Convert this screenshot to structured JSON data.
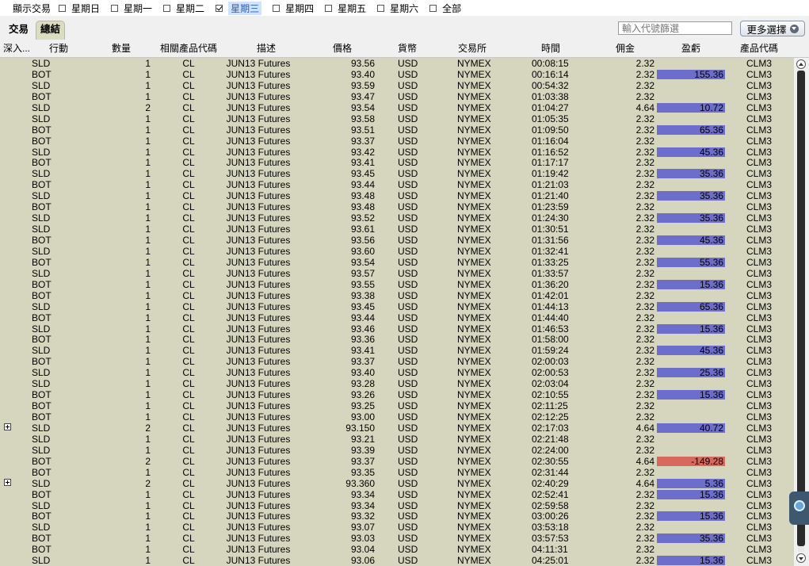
{
  "filter": {
    "title": "顯示交易",
    "days": [
      {
        "label": "星期日",
        "checked": false
      },
      {
        "label": "星期一",
        "checked": false
      },
      {
        "label": "星期二",
        "checked": false
      },
      {
        "label": "星期三",
        "checked": true
      },
      {
        "label": "星期四",
        "checked": false
      },
      {
        "label": "星期五",
        "checked": false
      },
      {
        "label": "星期六",
        "checked": false
      },
      {
        "label": "全部",
        "checked": false
      }
    ]
  },
  "tabs": [
    {
      "label": "交易",
      "active": false
    },
    {
      "label": "總結",
      "active": true
    }
  ],
  "search": {
    "placeholder": "輸入代號篩選"
  },
  "more_button": {
    "label": "更多選擇"
  },
  "columns": {
    "drill": "深入...",
    "action": "行動",
    "qty": "數量",
    "underlying": "相關產品代碼",
    "desc": "描述",
    "price": "價格",
    "currency": "貨幣",
    "exchange": "交易所",
    "time": "時間",
    "commission": "佣金",
    "pnl": "盈虧",
    "symbol": "產品代碼"
  },
  "colors": {
    "row_bg": "#d6d6bf",
    "pnl_positive": "#6d6dcc",
    "pnl_negative": "#d8685e"
  },
  "trades": [
    {
      "action": "SLD",
      "qty": "1",
      "underlying": "CL",
      "desc": "JUN13 Futures",
      "price": "93.56",
      "currency": "USD",
      "exchange": "NYMEX",
      "time": "00:08:15",
      "commission": "2.32",
      "pnl": "",
      "symbol": "CLM3",
      "expand": false
    },
    {
      "action": "BOT",
      "qty": "1",
      "underlying": "CL",
      "desc": "JUN13 Futures",
      "price": "93.40",
      "currency": "USD",
      "exchange": "NYMEX",
      "time": "00:16:14",
      "commission": "2.32",
      "pnl": "155.36",
      "symbol": "CLM3",
      "expand": false
    },
    {
      "action": "SLD",
      "qty": "1",
      "underlying": "CL",
      "desc": "JUN13 Futures",
      "price": "93.59",
      "currency": "USD",
      "exchange": "NYMEX",
      "time": "00:54:32",
      "commission": "2.32",
      "pnl": "",
      "symbol": "CLM3",
      "expand": false
    },
    {
      "action": "BOT",
      "qty": "1",
      "underlying": "CL",
      "desc": "JUN13 Futures",
      "price": "93.47",
      "currency": "USD",
      "exchange": "NYMEX",
      "time": "01:03:38",
      "commission": "2.32",
      "pnl": "",
      "symbol": "CLM3",
      "expand": false
    },
    {
      "action": "SLD",
      "qty": "2",
      "underlying": "CL",
      "desc": "JUN13 Futures",
      "price": "93.54",
      "currency": "USD",
      "exchange": "NYMEX",
      "time": "01:04:27",
      "commission": "4.64",
      "pnl": "10.72",
      "symbol": "CLM3",
      "expand": false
    },
    {
      "action": "SLD",
      "qty": "1",
      "underlying": "CL",
      "desc": "JUN13 Futures",
      "price": "93.58",
      "currency": "USD",
      "exchange": "NYMEX",
      "time": "01:05:35",
      "commission": "2.32",
      "pnl": "",
      "symbol": "CLM3",
      "expand": false
    },
    {
      "action": "BOT",
      "qty": "1",
      "underlying": "CL",
      "desc": "JUN13 Futures",
      "price": "93.51",
      "currency": "USD",
      "exchange": "NYMEX",
      "time": "01:09:50",
      "commission": "2.32",
      "pnl": "65.36",
      "symbol": "CLM3",
      "expand": false
    },
    {
      "action": "BOT",
      "qty": "1",
      "underlying": "CL",
      "desc": "JUN13 Futures",
      "price": "93.37",
      "currency": "USD",
      "exchange": "NYMEX",
      "time": "01:16:04",
      "commission": "2.32",
      "pnl": "",
      "symbol": "CLM3",
      "expand": false
    },
    {
      "action": "SLD",
      "qty": "1",
      "underlying": "CL",
      "desc": "JUN13 Futures",
      "price": "93.42",
      "currency": "USD",
      "exchange": "NYMEX",
      "time": "01:16:52",
      "commission": "2.32",
      "pnl": "45.36",
      "symbol": "CLM3",
      "expand": false
    },
    {
      "action": "BOT",
      "qty": "1",
      "underlying": "CL",
      "desc": "JUN13 Futures",
      "price": "93.41",
      "currency": "USD",
      "exchange": "NYMEX",
      "time": "01:17:17",
      "commission": "2.32",
      "pnl": "",
      "symbol": "CLM3",
      "expand": false
    },
    {
      "action": "SLD",
      "qty": "1",
      "underlying": "CL",
      "desc": "JUN13 Futures",
      "price": "93.45",
      "currency": "USD",
      "exchange": "NYMEX",
      "time": "01:19:42",
      "commission": "2.32",
      "pnl": "35.36",
      "symbol": "CLM3",
      "expand": false
    },
    {
      "action": "BOT",
      "qty": "1",
      "underlying": "CL",
      "desc": "JUN13 Futures",
      "price": "93.44",
      "currency": "USD",
      "exchange": "NYMEX",
      "time": "01:21:03",
      "commission": "2.32",
      "pnl": "",
      "symbol": "CLM3",
      "expand": false
    },
    {
      "action": "SLD",
      "qty": "1",
      "underlying": "CL",
      "desc": "JUN13 Futures",
      "price": "93.48",
      "currency": "USD",
      "exchange": "NYMEX",
      "time": "01:21:40",
      "commission": "2.32",
      "pnl": "35.36",
      "symbol": "CLM3",
      "expand": false
    },
    {
      "action": "BOT",
      "qty": "1",
      "underlying": "CL",
      "desc": "JUN13 Futures",
      "price": "93.48",
      "currency": "USD",
      "exchange": "NYMEX",
      "time": "01:23:59",
      "commission": "2.32",
      "pnl": "",
      "symbol": "CLM3",
      "expand": false
    },
    {
      "action": "SLD",
      "qty": "1",
      "underlying": "CL",
      "desc": "JUN13 Futures",
      "price": "93.52",
      "currency": "USD",
      "exchange": "NYMEX",
      "time": "01:24:30",
      "commission": "2.32",
      "pnl": "35.36",
      "symbol": "CLM3",
      "expand": false
    },
    {
      "action": "SLD",
      "qty": "1",
      "underlying": "CL",
      "desc": "JUN13 Futures",
      "price": "93.61",
      "currency": "USD",
      "exchange": "NYMEX",
      "time": "01:30:51",
      "commission": "2.32",
      "pnl": "",
      "symbol": "CLM3",
      "expand": false
    },
    {
      "action": "BOT",
      "qty": "1",
      "underlying": "CL",
      "desc": "JUN13 Futures",
      "price": "93.56",
      "currency": "USD",
      "exchange": "NYMEX",
      "time": "01:31:56",
      "commission": "2.32",
      "pnl": "45.36",
      "symbol": "CLM3",
      "expand": false
    },
    {
      "action": "SLD",
      "qty": "1",
      "underlying": "CL",
      "desc": "JUN13 Futures",
      "price": "93.60",
      "currency": "USD",
      "exchange": "NYMEX",
      "time": "01:32:41",
      "commission": "2.32",
      "pnl": "",
      "symbol": "CLM3",
      "expand": false
    },
    {
      "action": "BOT",
      "qty": "1",
      "underlying": "CL",
      "desc": "JUN13 Futures",
      "price": "93.54",
      "currency": "USD",
      "exchange": "NYMEX",
      "time": "01:33:25",
      "commission": "2.32",
      "pnl": "55.36",
      "symbol": "CLM3",
      "expand": false
    },
    {
      "action": "SLD",
      "qty": "1",
      "underlying": "CL",
      "desc": "JUN13 Futures",
      "price": "93.57",
      "currency": "USD",
      "exchange": "NYMEX",
      "time": "01:33:57",
      "commission": "2.32",
      "pnl": "",
      "symbol": "CLM3",
      "expand": false
    },
    {
      "action": "BOT",
      "qty": "1",
      "underlying": "CL",
      "desc": "JUN13 Futures",
      "price": "93.55",
      "currency": "USD",
      "exchange": "NYMEX",
      "time": "01:36:20",
      "commission": "2.32",
      "pnl": "15.36",
      "symbol": "CLM3",
      "expand": false
    },
    {
      "action": "BOT",
      "qty": "1",
      "underlying": "CL",
      "desc": "JUN13 Futures",
      "price": "93.38",
      "currency": "USD",
      "exchange": "NYMEX",
      "time": "01:42:01",
      "commission": "2.32",
      "pnl": "",
      "symbol": "CLM3",
      "expand": false
    },
    {
      "action": "SLD",
      "qty": "1",
      "underlying": "CL",
      "desc": "JUN13 Futures",
      "price": "93.45",
      "currency": "USD",
      "exchange": "NYMEX",
      "time": "01:44:13",
      "commission": "2.32",
      "pnl": "65.36",
      "symbol": "CLM3",
      "expand": false
    },
    {
      "action": "BOT",
      "qty": "1",
      "underlying": "CL",
      "desc": "JUN13 Futures",
      "price": "93.44",
      "currency": "USD",
      "exchange": "NYMEX",
      "time": "01:44:40",
      "commission": "2.32",
      "pnl": "",
      "symbol": "CLM3",
      "expand": false
    },
    {
      "action": "SLD",
      "qty": "1",
      "underlying": "CL",
      "desc": "JUN13 Futures",
      "price": "93.46",
      "currency": "USD",
      "exchange": "NYMEX",
      "time": "01:46:53",
      "commission": "2.32",
      "pnl": "15.36",
      "symbol": "CLM3",
      "expand": false
    },
    {
      "action": "BOT",
      "qty": "1",
      "underlying": "CL",
      "desc": "JUN13 Futures",
      "price": "93.36",
      "currency": "USD",
      "exchange": "NYMEX",
      "time": "01:58:00",
      "commission": "2.32",
      "pnl": "",
      "symbol": "CLM3",
      "expand": false
    },
    {
      "action": "SLD",
      "qty": "1",
      "underlying": "CL",
      "desc": "JUN13 Futures",
      "price": "93.41",
      "currency": "USD",
      "exchange": "NYMEX",
      "time": "01:59:24",
      "commission": "2.32",
      "pnl": "45.36",
      "symbol": "CLM3",
      "expand": false
    },
    {
      "action": "BOT",
      "qty": "1",
      "underlying": "CL",
      "desc": "JUN13 Futures",
      "price": "93.37",
      "currency": "USD",
      "exchange": "NYMEX",
      "time": "02:00:03",
      "commission": "2.32",
      "pnl": "",
      "symbol": "CLM3",
      "expand": false
    },
    {
      "action": "SLD",
      "qty": "1",
      "underlying": "CL",
      "desc": "JUN13 Futures",
      "price": "93.40",
      "currency": "USD",
      "exchange": "NYMEX",
      "time": "02:00:53",
      "commission": "2.32",
      "pnl": "25.36",
      "symbol": "CLM3",
      "expand": false
    },
    {
      "action": "SLD",
      "qty": "1",
      "underlying": "CL",
      "desc": "JUN13 Futures",
      "price": "93.28",
      "currency": "USD",
      "exchange": "NYMEX",
      "time": "02:03:04",
      "commission": "2.32",
      "pnl": "",
      "symbol": "CLM3",
      "expand": false
    },
    {
      "action": "BOT",
      "qty": "1",
      "underlying": "CL",
      "desc": "JUN13 Futures",
      "price": "93.26",
      "currency": "USD",
      "exchange": "NYMEX",
      "time": "02:10:55",
      "commission": "2.32",
      "pnl": "15.36",
      "symbol": "CLM3",
      "expand": false
    },
    {
      "action": "BOT",
      "qty": "1",
      "underlying": "CL",
      "desc": "JUN13 Futures",
      "price": "93.25",
      "currency": "USD",
      "exchange": "NYMEX",
      "time": "02:11:25",
      "commission": "2.32",
      "pnl": "",
      "symbol": "CLM3",
      "expand": false
    },
    {
      "action": "BOT",
      "qty": "1",
      "underlying": "CL",
      "desc": "JUN13 Futures",
      "price": "93.00",
      "currency": "USD",
      "exchange": "NYMEX",
      "time": "02:12:25",
      "commission": "2.32",
      "pnl": "",
      "symbol": "CLM3",
      "expand": false
    },
    {
      "action": "SLD",
      "qty": "2",
      "underlying": "CL",
      "desc": "JUN13 Futures",
      "price": "93.150",
      "currency": "USD",
      "exchange": "NYMEX",
      "time": "02:17:03",
      "commission": "4.64",
      "pnl": "40.72",
      "symbol": "CLM3",
      "expand": true
    },
    {
      "action": "SLD",
      "qty": "1",
      "underlying": "CL",
      "desc": "JUN13 Futures",
      "price": "93.21",
      "currency": "USD",
      "exchange": "NYMEX",
      "time": "02:21:48",
      "commission": "2.32",
      "pnl": "",
      "symbol": "CLM3",
      "expand": false
    },
    {
      "action": "SLD",
      "qty": "1",
      "underlying": "CL",
      "desc": "JUN13 Futures",
      "price": "93.39",
      "currency": "USD",
      "exchange": "NYMEX",
      "time": "02:24:00",
      "commission": "2.32",
      "pnl": "",
      "symbol": "CLM3",
      "expand": false
    },
    {
      "action": "BOT",
      "qty": "2",
      "underlying": "CL",
      "desc": "JUN13 Futures",
      "price": "93.37",
      "currency": "USD",
      "exchange": "NYMEX",
      "time": "02:30:55",
      "commission": "4.64",
      "pnl": "-149.28",
      "symbol": "CLM3",
      "expand": false
    },
    {
      "action": "BOT",
      "qty": "1",
      "underlying": "CL",
      "desc": "JUN13 Futures",
      "price": "93.35",
      "currency": "USD",
      "exchange": "NYMEX",
      "time": "02:31:44",
      "commission": "2.32",
      "pnl": "",
      "symbol": "CLM3",
      "expand": false
    },
    {
      "action": "SLD",
      "qty": "2",
      "underlying": "CL",
      "desc": "JUN13 Futures",
      "price": "93.360",
      "currency": "USD",
      "exchange": "NYMEX",
      "time": "02:40:29",
      "commission": "4.64",
      "pnl": "5.36",
      "symbol": "CLM3",
      "expand": true
    },
    {
      "action": "BOT",
      "qty": "1",
      "underlying": "CL",
      "desc": "JUN13 Futures",
      "price": "93.34",
      "currency": "USD",
      "exchange": "NYMEX",
      "time": "02:52:41",
      "commission": "2.32",
      "pnl": "15.36",
      "symbol": "CLM3",
      "expand": false
    },
    {
      "action": "SLD",
      "qty": "1",
      "underlying": "CL",
      "desc": "JUN13 Futures",
      "price": "93.34",
      "currency": "USD",
      "exchange": "NYMEX",
      "time": "02:59:58",
      "commission": "2.32",
      "pnl": "",
      "symbol": "CLM3",
      "expand": false
    },
    {
      "action": "BOT",
      "qty": "1",
      "underlying": "CL",
      "desc": "JUN13 Futures",
      "price": "93.32",
      "currency": "USD",
      "exchange": "NYMEX",
      "time": "03:00:26",
      "commission": "2.32",
      "pnl": "15.36",
      "symbol": "CLM3",
      "expand": false
    },
    {
      "action": "SLD",
      "qty": "1",
      "underlying": "CL",
      "desc": "JUN13 Futures",
      "price": "93.07",
      "currency": "USD",
      "exchange": "NYMEX",
      "time": "03:53:18",
      "commission": "2.32",
      "pnl": "",
      "symbol": "CLM3",
      "expand": false
    },
    {
      "action": "BOT",
      "qty": "1",
      "underlying": "CL",
      "desc": "JUN13 Futures",
      "price": "93.03",
      "currency": "USD",
      "exchange": "NYMEX",
      "time": "03:57:53",
      "commission": "2.32",
      "pnl": "35.36",
      "symbol": "CLM3",
      "expand": false
    },
    {
      "action": "BOT",
      "qty": "1",
      "underlying": "CL",
      "desc": "JUN13 Futures",
      "price": "93.04",
      "currency": "USD",
      "exchange": "NYMEX",
      "time": "04:11:31",
      "commission": "2.32",
      "pnl": "",
      "symbol": "CLM3",
      "expand": false
    },
    {
      "action": "SLD",
      "qty": "1",
      "underlying": "CL",
      "desc": "JUN13 Futures",
      "price": "93.06",
      "currency": "USD",
      "exchange": "NYMEX",
      "time": "04:25:01",
      "commission": "2.32",
      "pnl": "15.36",
      "symbol": "CLM3",
      "expand": false
    }
  ]
}
